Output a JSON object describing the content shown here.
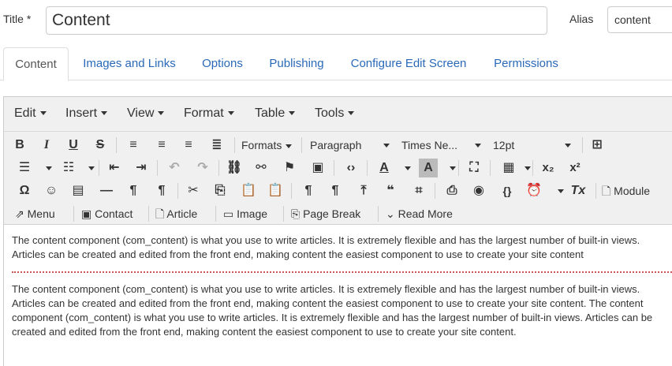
{
  "form": {
    "title_label": "Title *",
    "title_value": "Content",
    "alias_label": "Alias",
    "alias_value": "content"
  },
  "tabs": [
    "Content",
    "Images and Links",
    "Options",
    "Publishing",
    "Configure Edit Screen",
    "Permissions"
  ],
  "menubar": [
    "Edit",
    "Insert",
    "View",
    "Format",
    "Table",
    "Tools"
  ],
  "toolbar": {
    "formats": "Formats",
    "paragraph": "Paragraph",
    "font": "Times Ne...",
    "size": "12pt",
    "module": "Module",
    "menu": "Menu",
    "contact": "Contact",
    "article": "Article",
    "image": "Image",
    "page_break": "Page Break",
    "read_more": "Read More"
  },
  "content": {
    "para1": "The content component (com_content) is what you use to write articles. It is extremely flexible and has the largest number of built-in views. Articles can be created and edited from the front end, making content the easiest component to use to create your site content",
    "para2": "The content component (com_content) is what you use to write articles. It is extremely flexible and has the largest number of built-in views. Articles can be created and edited from the front end, making content the easiest component to use to create your site content. The content component (com_content) is what you use to write articles. It is extremely flexible and has the largest number of built-in views. Articles can be created and edited from the front end, making content the easiest component to use to create your site content."
  }
}
